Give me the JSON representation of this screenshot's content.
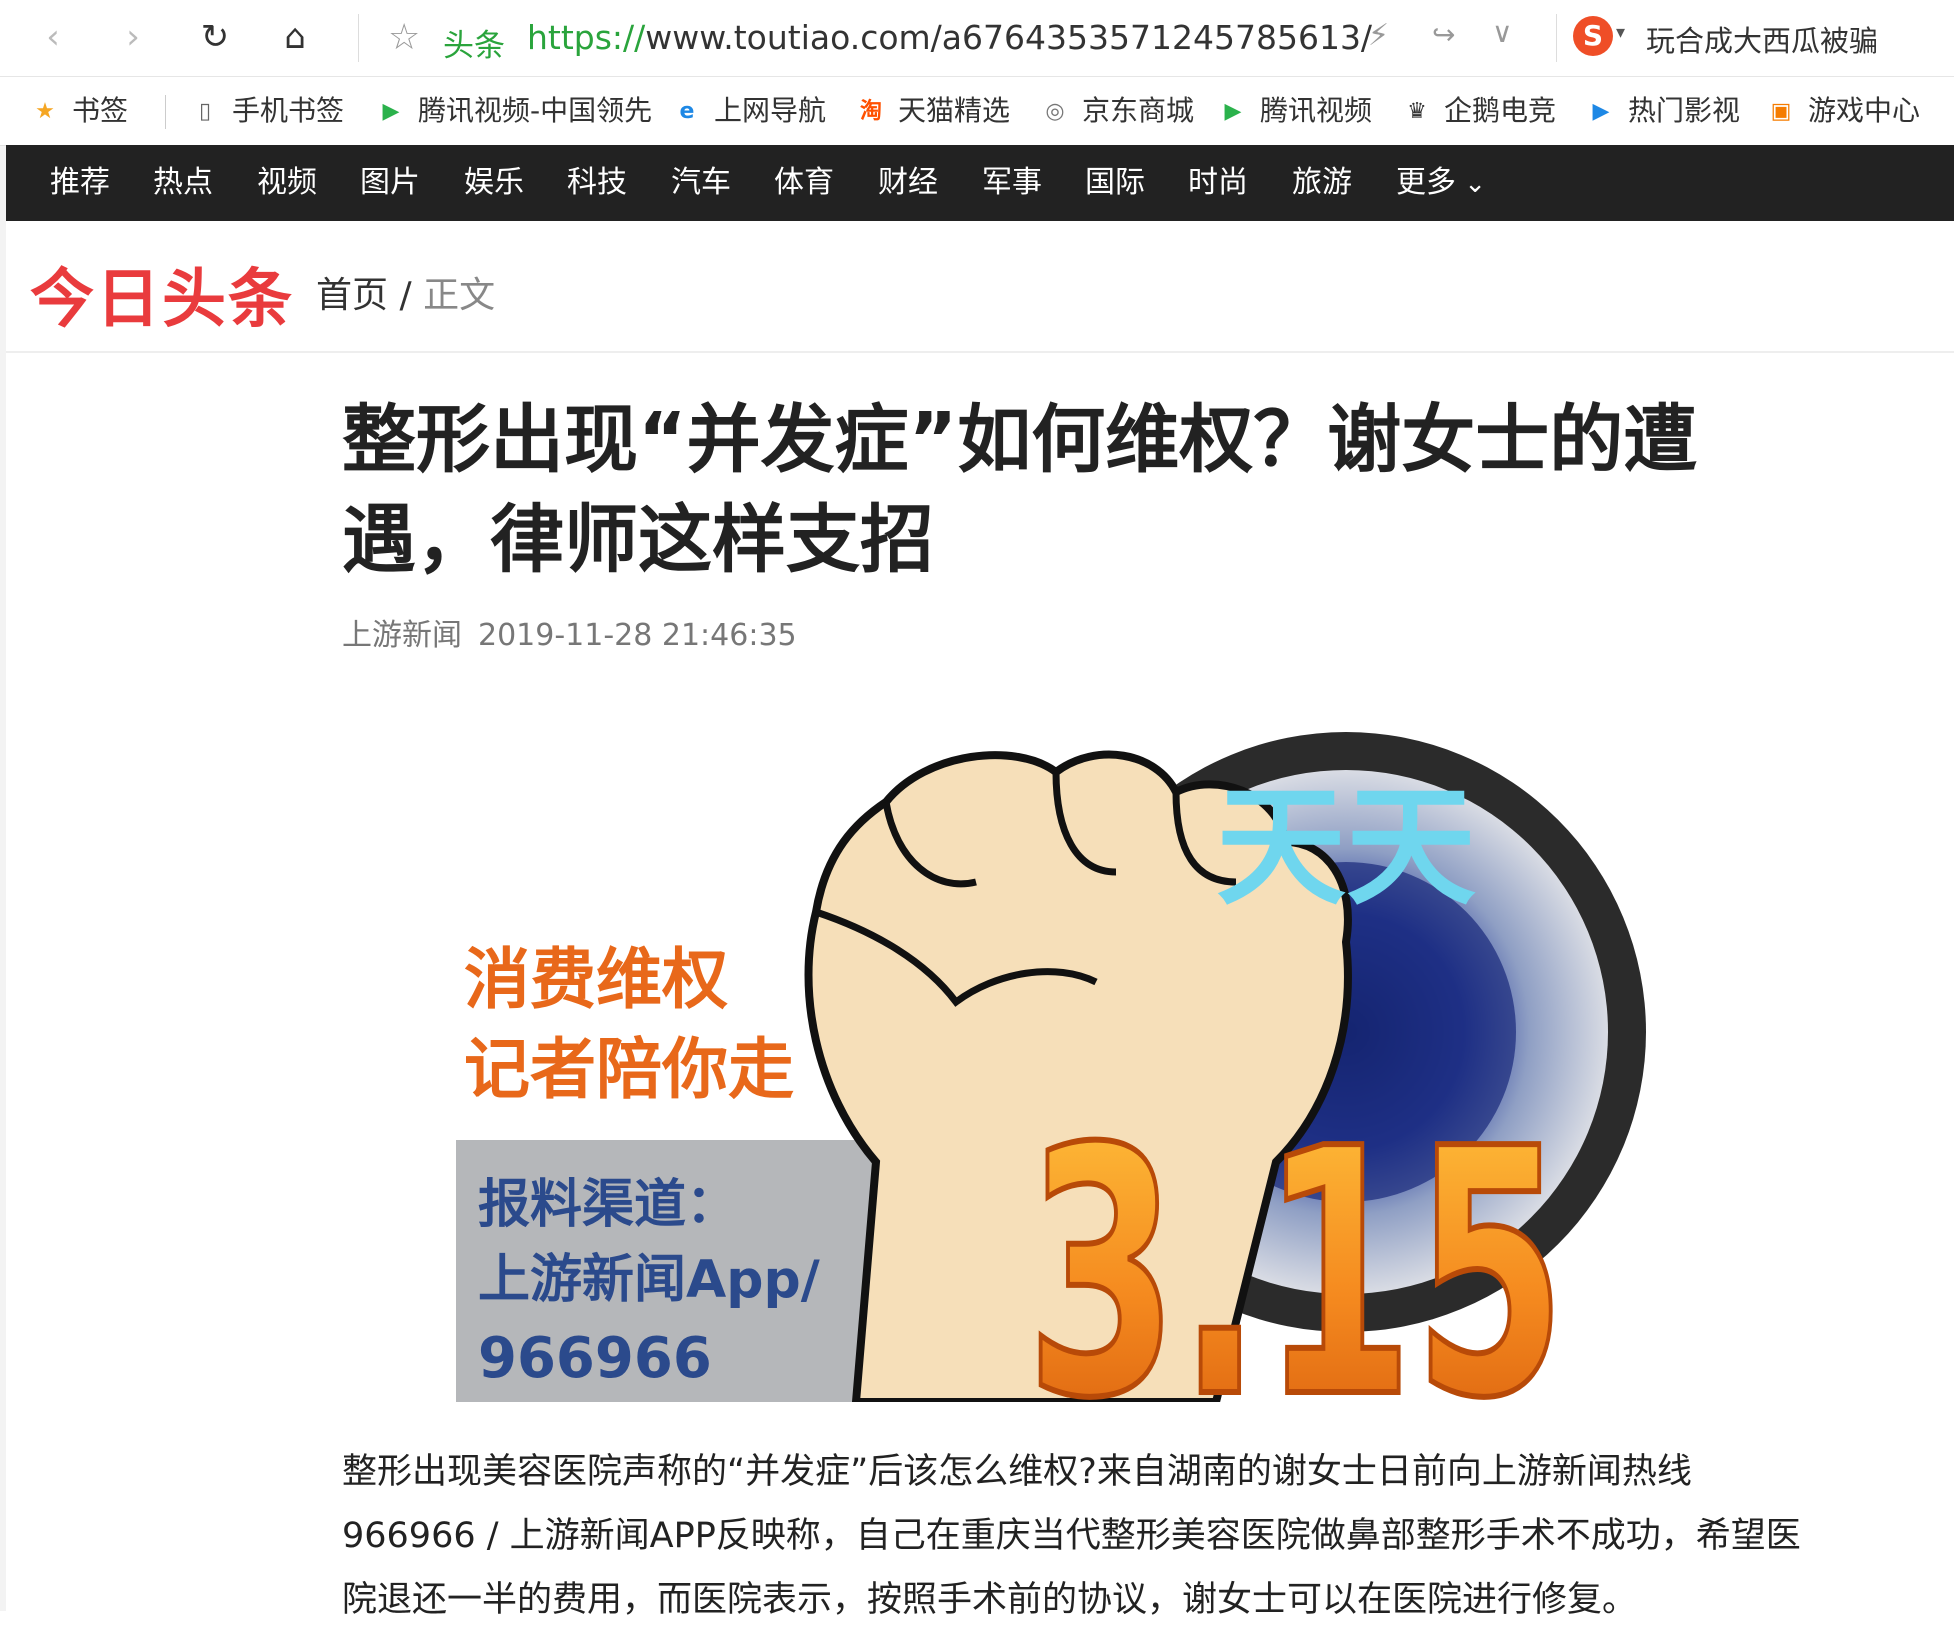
{
  "browser": {
    "site_label": "头条",
    "url_scheme": "https://",
    "url_rest": "www.toutiao.com/a6764353571245785613/",
    "search_hint": "玩合成大西瓜被骗"
  },
  "bookmarks": [
    {
      "label": "书签",
      "icon": "star-icon",
      "color": "#f5a623"
    },
    {
      "label": "手机书签",
      "icon": "phone-icon",
      "color": "#666666"
    },
    {
      "label": "腾讯视频-中国领先",
      "icon": "tencent-video-icon",
      "color": "#2bb24c"
    },
    {
      "label": "上网导航",
      "icon": "ie-icon",
      "color": "#1e88e5"
    },
    {
      "label": "天猫精选",
      "icon": "taobao-icon",
      "color": "#ff5000"
    },
    {
      "label": "京东商城",
      "icon": "globe-icon",
      "color": "#777777"
    },
    {
      "label": "腾讯视频",
      "icon": "tencent-video-icon",
      "color": "#2bb24c"
    },
    {
      "label": "企鹅电竞",
      "icon": "penguin-esports-icon",
      "color": "#333333"
    },
    {
      "label": "热门影视",
      "icon": "play-icon",
      "color": "#1e88e5"
    },
    {
      "label": "游戏中心",
      "icon": "gamepad-icon",
      "color": "#f57c00"
    }
  ],
  "categories": [
    "推荐",
    "热点",
    "视频",
    "图片",
    "娱乐",
    "科技",
    "汽车",
    "体育",
    "财经",
    "军事",
    "国际",
    "时尚",
    "旅游",
    "更多"
  ],
  "header": {
    "logo": "今日头条",
    "breadcrumb_home": "首页",
    "breadcrumb_sep": "/",
    "breadcrumb_current": "正文"
  },
  "article": {
    "title": "整形出现“并发症”如何维权？谢女士的遭遇，律师这样支招",
    "source": "上游新闻",
    "datetime": "2019-11-28 21:46:35",
    "body": "整形出现美容医院声称的“并发症”后该怎么维权?来自湖南的谢女士日前向上游新闻热线966966 / 上游新闻APP反映称，自己在重庆当代整形美容医院做鼻部整形手术不成功，希望医院退还一半的费用，而医院表示，按照手术前的协议，谢女士可以在医院进行修复。"
  },
  "poster": {
    "line1": "消费维权",
    "line2": "记者陪你走",
    "report_title": "报料渠道：",
    "report_line2": "上游新闻App/",
    "report_phone": "966966",
    "tiantian": "天天",
    "number": "3.15"
  },
  "colors": {
    "brand_red": "#e93b3d",
    "nav_bg": "#222222",
    "url_green": "#2aa43c",
    "poster_orange": "#e8681a",
    "poster_cyan": "#6fd6ee",
    "poster_blue_text": "#2b4a8c"
  }
}
